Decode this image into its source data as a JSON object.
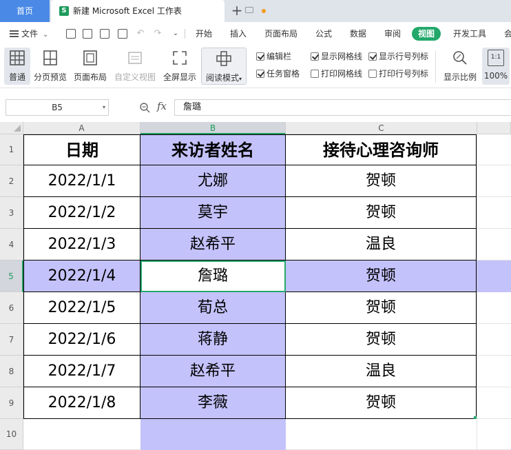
{
  "tabs": {
    "home": "首页",
    "doc_icon": "S",
    "doc_title": "新建 Microsoft Excel 工作表",
    "add": "+"
  },
  "menu": {
    "file": "文件",
    "items": [
      "开始",
      "插入",
      "页面布局",
      "公式",
      "数据",
      "审阅",
      "视图",
      "开发工具",
      "会"
    ],
    "active": "视图"
  },
  "ribbon": {
    "buttons": [
      "普通",
      "分页预览",
      "页面布局",
      "自定义视图",
      "全屏显示",
      "阅读模式"
    ],
    "active": "普通",
    "disabled": "自定义视图",
    "checks": [
      {
        "label": "编辑栏",
        "checked": true
      },
      {
        "label": "显示网格线",
        "checked": true
      },
      {
        "label": "显示行号列标",
        "checked": true
      },
      {
        "label": "任务窗格",
        "checked": true
      },
      {
        "label": "打印网格线",
        "checked": false
      },
      {
        "label": "打印行号列标",
        "checked": false
      }
    ],
    "zoom_button": "显示比例",
    "zoom_icon_text": "1:1",
    "zoom_value": "100%"
  },
  "formula_bar": {
    "cell_ref": "B5",
    "fx": "fx",
    "value": "詹璐"
  },
  "grid": {
    "columns": [
      "A",
      "B",
      "C"
    ],
    "selected_column": "B",
    "rows": [
      "1",
      "2",
      "3",
      "4",
      "5",
      "6",
      "7",
      "8",
      "9",
      "10"
    ],
    "selected_row": "5",
    "header": [
      "日期",
      "来访者姓名",
      "接待心理咨询师"
    ],
    "data": [
      [
        "2022/1/1",
        "尤娜",
        "贺顿"
      ],
      [
        "2022/1/2",
        "莫宇",
        "贺顿"
      ],
      [
        "2022/1/3",
        "赵希平",
        "温良"
      ],
      [
        "2022/1/4",
        "詹璐",
        "贺顿"
      ],
      [
        "2022/1/5",
        "荀总",
        "贺顿"
      ],
      [
        "2022/1/6",
        "蒋静",
        "贺顿"
      ],
      [
        "2022/1/7",
        "赵希平",
        "温良"
      ],
      [
        "2022/1/8",
        "李薇",
        "贺顿"
      ]
    ],
    "highlight_color": "#c4c2fb",
    "active_border_color": "#23a86b"
  }
}
